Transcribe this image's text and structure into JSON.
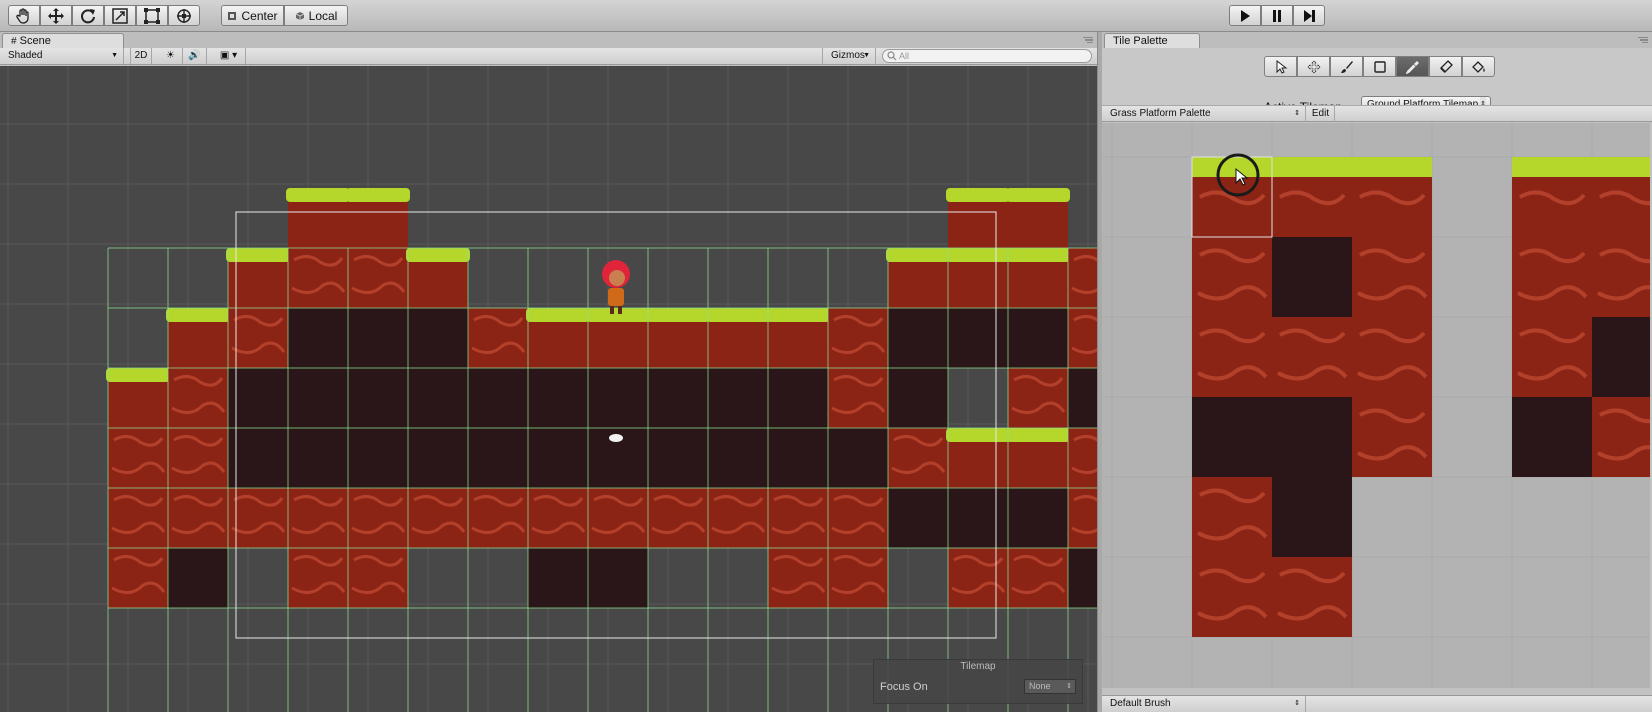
{
  "toolbar": {
    "tools": [
      {
        "icon": "hand-icon"
      },
      {
        "icon": "move-icon"
      },
      {
        "icon": "rotate-icon"
      },
      {
        "icon": "scale-icon"
      },
      {
        "icon": "rect-tool-icon"
      },
      {
        "icon": "transform-icon"
      }
    ],
    "pivot_label": "Center",
    "space_label": "Local",
    "playback": [
      "play-icon",
      "pause-icon",
      "step-icon"
    ]
  },
  "scene": {
    "tab_label": "Scene",
    "shading_mode": "Shaded",
    "mode_2d": "2D",
    "gizmos_label": "Gizmos",
    "search_placeholder": "All",
    "overlay": {
      "title": "Tilemap",
      "focus_label": "Focus On",
      "focus_value": "None"
    }
  },
  "tile_palette": {
    "tab_label": "Tile Palette",
    "tools": [
      "select-icon",
      "move-icon",
      "paint-brush-icon",
      "box-fill-icon",
      "picker-icon",
      "eraser-icon",
      "fill-icon"
    ],
    "active_tool_index": 4,
    "active_tilemap_label": "Active Tilemap",
    "active_tilemap_value": "Ground Platform Tilemap",
    "palette_name": "Grass Platform Palette",
    "edit_label": "Edit",
    "brush_name": "Default Brush"
  },
  "colors": {
    "grass": "#b5d62b",
    "rock": "#8c2416",
    "rock_dark": "#2a1618",
    "grid": "#8fe08f"
  }
}
